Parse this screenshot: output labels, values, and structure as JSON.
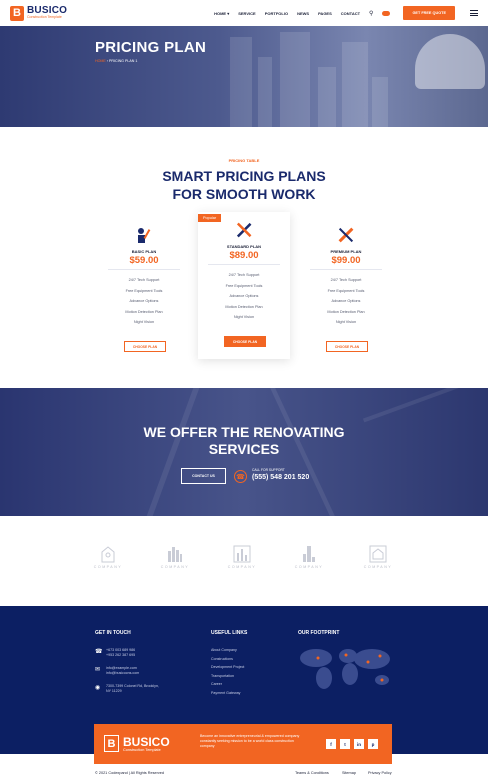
{
  "header": {
    "logo_letter": "B",
    "logo_name": "BUSICO",
    "logo_tagline": "Construction Template",
    "nav": [
      "HOME ▾",
      "SERVICE",
      "PORTFOLIO",
      "NEWS",
      "PAGES",
      "CONTACT"
    ],
    "quote_button": "GET FREE QUOTE"
  },
  "hero": {
    "title": "PRICING PLAN",
    "breadcrumb_home": "HOME",
    "breadcrumb_sep": "›",
    "breadcrumb_current": "PRICING PLAN 1"
  },
  "pricing": {
    "tag": "PRICING TABLE",
    "title_line1": "SMART PRICING PLANS",
    "title_line2": "FOR SMOOTH WORK",
    "popular_badge": "Popular",
    "plans": [
      {
        "name": "BASIC PLAN",
        "price": "$59.00",
        "features": [
          "24/7 Tech Support",
          "Free Equipment Tools",
          "Advance Options",
          "Motion Detection Plan",
          "Night Vision"
        ],
        "button": "CHOOSE PLAN"
      },
      {
        "name": "STANDARD PLAN",
        "price": "$89.00",
        "features": [
          "24/7 Tech Support",
          "Free Equipment Tools",
          "Advance Options",
          "Motion Detection Plan",
          "Night Vision"
        ],
        "button": "CHOOSE PLAN"
      },
      {
        "name": "PREMIUM PLAN",
        "price": "$99.00",
        "features": [
          "24/7 Tech Support",
          "Free Equipment Tools",
          "Advance Options",
          "Motion Detection Plan",
          "Night Vision"
        ],
        "button": "CHOOSE PLAN"
      }
    ]
  },
  "renovating": {
    "title_line1": "WE OFFER THE RENOVATING",
    "title_line2": "SERVICES",
    "contact_button": "CONTACT US",
    "call_label": "CALL FOR SUPPORT",
    "phone": "(555) 548 201 520"
  },
  "partners": [
    "COMPANY",
    "COMPANY",
    "COMPANY",
    "COMPANY",
    "COMPANY"
  ],
  "footer": {
    "get_in_touch": "GET IN TOUCH",
    "phones": [
      "+673 003 689 986",
      "+953 262 387 695"
    ],
    "emails": [
      "info@example.com",
      "info@busicocns.com"
    ],
    "address": [
      "7300-7399 Colonel Rd, Brooklyn,",
      "NY 11229"
    ],
    "useful_links_title": "USEFUL LINKS",
    "useful_links": [
      "About Company",
      "Constructions",
      "Development Project",
      "Transportation",
      "Career",
      "Payment Gateway"
    ],
    "footprint_title": "OUR FOOTPRINT",
    "banner_letter": "B",
    "banner_name": "BUSICO",
    "banner_tagline": "Construction Template",
    "banner_text": "Become an innovative entrepreneurial & empowered company constantly seeking mission to be a world class construction company",
    "social": [
      "f",
      "t",
      "in",
      "p"
    ],
    "copyright": "© 2021 Codexpand  |  All Rights Reserved",
    "bottom_links": [
      "Teams & Conditions",
      "Sitemap",
      "Privacy Policy"
    ]
  },
  "colors": {
    "accent": "#f26522",
    "navy": "#0c1f63",
    "brand": "#1a2a6c"
  }
}
